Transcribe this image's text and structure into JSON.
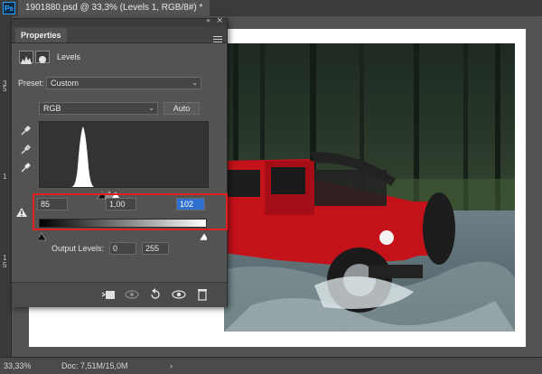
{
  "window": {
    "app_logo": "Ps",
    "doc_tab_title": "1901880.psd @ 33,3% (Levels 1, RGB/8#) *"
  },
  "ruler": {
    "labels": [
      "3",
      "5",
      "1",
      "1",
      "5"
    ]
  },
  "panel": {
    "tab_label": "Properties",
    "collapse_glyph": "«",
    "close_glyph": "×",
    "header_title": "Levels",
    "preset_label": "Preset:",
    "preset_value": "Custom",
    "channel_value": "RGB",
    "auto_label": "Auto",
    "input_black": "85",
    "input_gamma": "1,00",
    "input_white": "102",
    "output_label": "Output Levels:",
    "output_black": "0",
    "output_white": "255"
  },
  "status_bar": {
    "zoom": "33,33%",
    "doc_info": "Doc: 7,51M/15,0M",
    "arrow_glyph": "›"
  },
  "colors": {
    "accent_blue": "#2f6fd0",
    "highlight_red": "#e02020",
    "jeep_red": "#c4121b"
  },
  "icons": [
    "levels-icon",
    "mask-icon",
    "eyedropper-black-icon",
    "eyedropper-gray-icon",
    "eyedropper-white-icon",
    "warning-icon",
    "clip-to-layer-icon",
    "view-previous-icon",
    "reset-icon",
    "visibility-eye-icon",
    "trash-icon",
    "panel-menu-icon"
  ]
}
